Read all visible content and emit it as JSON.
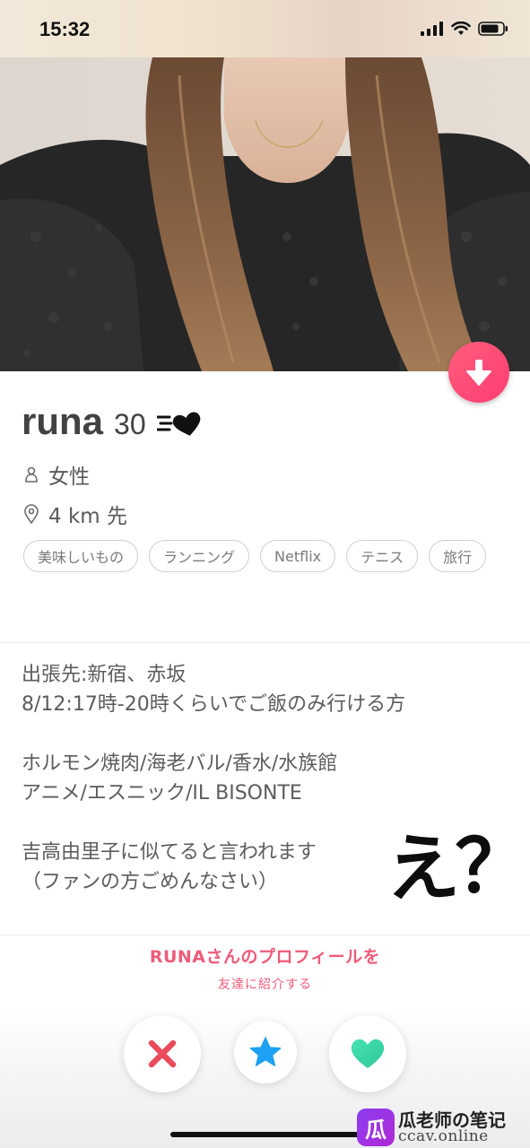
{
  "status_bar": {
    "time": "15:32"
  },
  "profile": {
    "name": "runa",
    "age": "30",
    "gender": "女性",
    "distance": "4 km 先",
    "tags": [
      "美味しいもの",
      "ランニング",
      "Netflix",
      "テニス",
      "旅行"
    ]
  },
  "bio": {
    "p1_line1": "出張先:新宿、赤坂",
    "p1_line2": "8/12:17時-20時くらいでご飯のみ行ける方",
    "p2_line1": "ホルモン焼肉/海老バル/香水/水族館",
    "p2_line2": "アニメ/エスニック/IL BISONTE",
    "p3_line1": "吉高由里子に似てると言われます",
    "p3_line2": "（ファンの方ごめんなさい）"
  },
  "annotation": {
    "text": "え？"
  },
  "share": {
    "title": "RUNAさんのプロフィールを",
    "subtitle": "友達に紹介する"
  },
  "watermark": {
    "logo_char": "瓜",
    "line1": "瓜老师の笔记",
    "line2": "ccav.online"
  },
  "icons": {
    "down_button": "arrow-down-icon",
    "gender": "person-icon",
    "location": "location-pin-icon",
    "nope": "x-icon",
    "super_like": "star-icon",
    "like": "heart-icon",
    "badge": "speed-heart-icon"
  },
  "colors": {
    "accent_pink": "#fe3c72",
    "nope_red": "#ea4a5a",
    "super_like_blue": "#1da1f2",
    "like_green": "#3ed6a3"
  }
}
